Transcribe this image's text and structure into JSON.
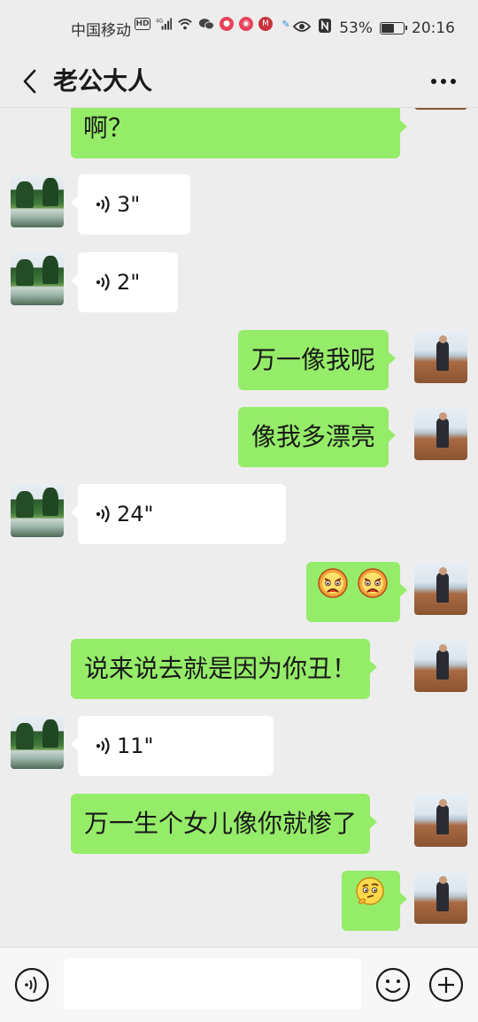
{
  "status_bar": {
    "carrier": "中国移动",
    "network": "4G",
    "hd": "HD",
    "battery_text": "53%",
    "battery_level": 0.53,
    "time": "20:16"
  },
  "nav": {
    "title": "老公大人"
  },
  "messages": [
    {
      "side": "right",
      "type": "text",
      "text": "啊？"
    },
    {
      "side": "left",
      "type": "voice",
      "duration": "3\""
    },
    {
      "side": "left",
      "type": "voice",
      "duration": "2\""
    },
    {
      "side": "right",
      "type": "text",
      "text": "万一像我呢"
    },
    {
      "side": "right",
      "type": "text",
      "text": "像我多漂亮"
    },
    {
      "side": "left",
      "type": "voice",
      "duration": "24\""
    },
    {
      "side": "right",
      "type": "emoji",
      "emojis": [
        "angry-face-emoji",
        "angry-face-emoji"
      ]
    },
    {
      "side": "right",
      "type": "text",
      "text": "说来说去就是因为你丑！"
    },
    {
      "side": "left",
      "type": "voice",
      "duration": "11\""
    },
    {
      "side": "right",
      "type": "text",
      "text": "万一生个女儿像你就惨了"
    },
    {
      "side": "right",
      "type": "emoji",
      "emojis": [
        "thinking-face-emoji"
      ]
    }
  ],
  "input_bar": {
    "placeholder": "",
    "icons": [
      "voice-input-icon",
      "emoji-icon",
      "plus-icon"
    ]
  },
  "colors": {
    "background": "#ededed",
    "bubble_self": "#95ec69",
    "bubble_other": "#ffffff"
  }
}
